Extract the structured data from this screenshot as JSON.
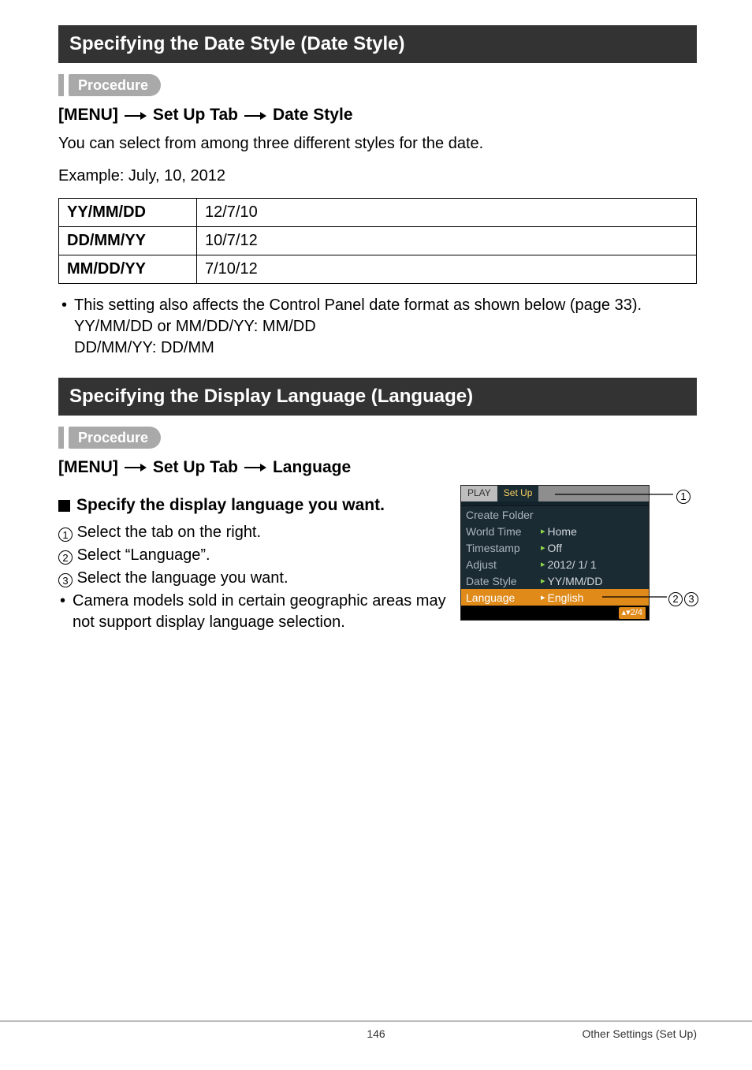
{
  "section1": {
    "heading": "Specifying the Date Style (Date Style)",
    "procedure_label": "Procedure",
    "path": {
      "a": "[MENU]",
      "b": "Set Up Tab",
      "c": "Date Style"
    },
    "intro": "You can select from among three different styles for the date.",
    "example": "Example: July, 10, 2012",
    "table": {
      "r1": {
        "fmt": "YY/MM/DD",
        "val": "12/7/10"
      },
      "r2": {
        "fmt": "DD/MM/YY",
        "val": "10/7/12"
      },
      "r3": {
        "fmt": "MM/DD/YY",
        "val": "7/10/12"
      }
    },
    "note_line1": "This setting also affects the Control Panel date format as shown below (page 33).",
    "note_line2": "YY/MM/DD or MM/DD/YY: MM/DD",
    "note_line3": "DD/MM/YY: DD/MM"
  },
  "section2": {
    "heading": "Specifying the Display Language (Language)",
    "procedure_label": "Procedure",
    "path": {
      "a": "[MENU]",
      "b": "Set Up Tab",
      "c": "Language"
    },
    "specify_heading": "Specify the display language you want.",
    "steps": {
      "s1": "Select the tab on the right.",
      "s2": "Select “Language”.",
      "s3": "Select the language you want."
    },
    "bullet": "Camera models sold in certain geographic areas may not support display language selection.",
    "nums": {
      "n1": "1",
      "n2": "2",
      "n3": "3"
    }
  },
  "shot": {
    "tab_play": "PLAY",
    "tab_setup": "Set Up",
    "items": {
      "create_folder": {
        "label": "Create Folder",
        "value": ""
      },
      "world_time": {
        "label": "World Time",
        "value": "Home"
      },
      "timestamp": {
        "label": "Timestamp",
        "value": "Off"
      },
      "adjust": {
        "label": "Adjust",
        "value": "2012/  1/  1"
      },
      "date_style": {
        "label": "Date Style",
        "value": "YY/MM/DD"
      },
      "language": {
        "label": "Language",
        "value": "English"
      }
    },
    "pager": "▴▾2/4"
  },
  "footer": {
    "page": "146",
    "section": "Other Settings (Set Up)"
  }
}
